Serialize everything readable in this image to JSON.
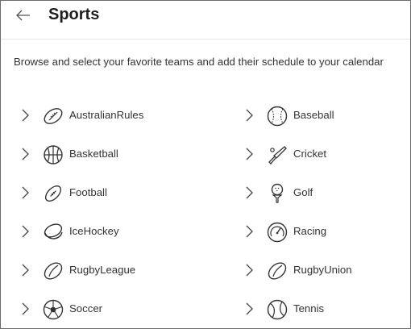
{
  "header": {
    "title": "Sports"
  },
  "description": "Browse and select your favorite teams and add their schedule to your calendar",
  "sports": [
    {
      "label": "AustralianRules",
      "icon": "australian-rules-ball-icon"
    },
    {
      "label": "Baseball",
      "icon": "baseball-icon"
    },
    {
      "label": "Basketball",
      "icon": "basketball-icon"
    },
    {
      "label": "Cricket",
      "icon": "cricket-bat-icon"
    },
    {
      "label": "Football",
      "icon": "football-icon"
    },
    {
      "label": "Golf",
      "icon": "golf-ball-tee-icon"
    },
    {
      "label": "IceHockey",
      "icon": "hockey-puck-icon"
    },
    {
      "label": "Racing",
      "icon": "speedometer-icon"
    },
    {
      "label": "RugbyLeague",
      "icon": "rugby-league-ball-icon"
    },
    {
      "label": "RugbyUnion",
      "icon": "rugby-union-ball-icon"
    },
    {
      "label": "Soccer",
      "icon": "soccer-ball-icon"
    },
    {
      "label": "Tennis",
      "icon": "tennis-ball-icon"
    }
  ]
}
